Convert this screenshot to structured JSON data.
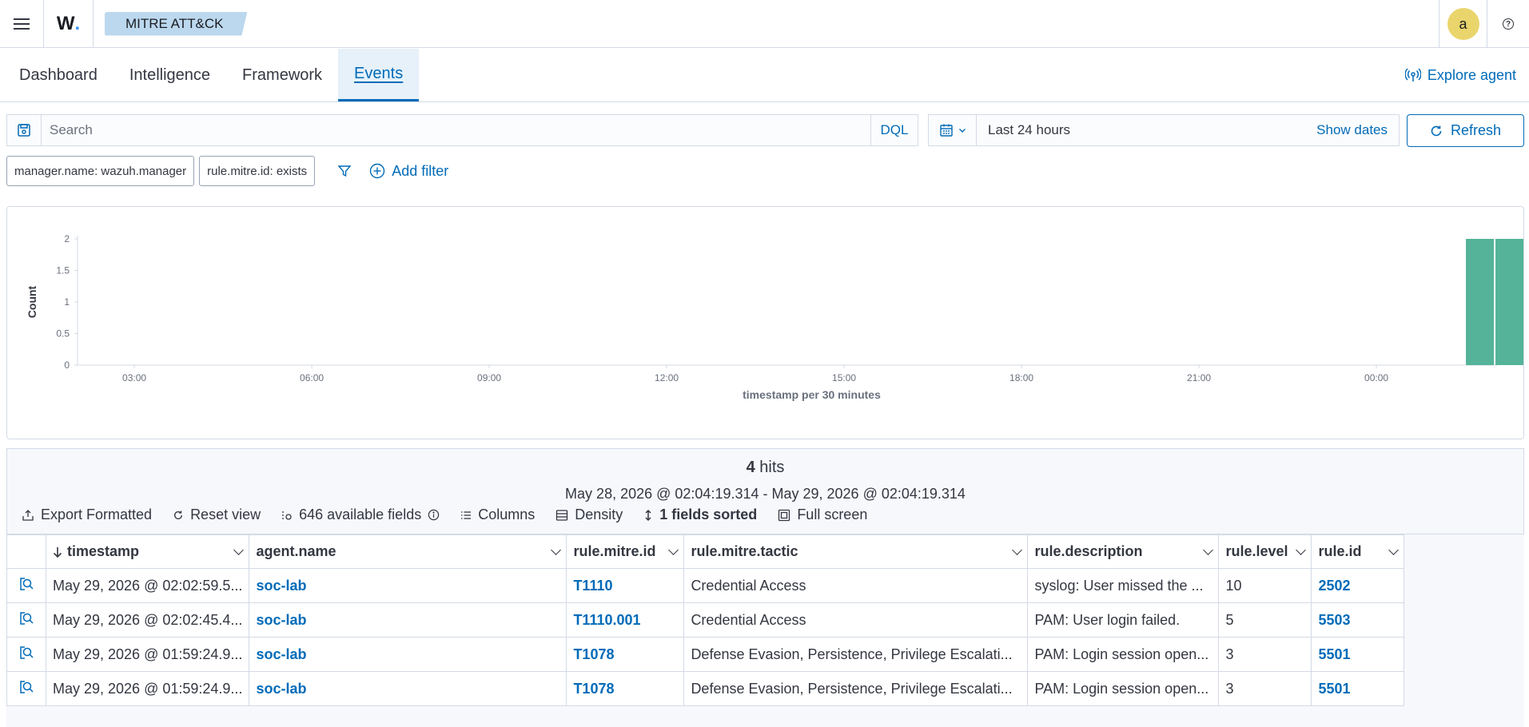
{
  "header": {
    "logo": "W",
    "breadcrumb": "MITRE ATT&CK",
    "avatar_letter": "a",
    "help_glyph": "?"
  },
  "tabs": [
    {
      "label": "Dashboard",
      "active": false
    },
    {
      "label": "Intelligence",
      "active": false
    },
    {
      "label": "Framework",
      "active": false
    },
    {
      "label": "Events",
      "active": true
    }
  ],
  "explore_agent": "Explore agent",
  "query": {
    "placeholder": "Search",
    "value": "",
    "language": "DQL"
  },
  "date": {
    "range": "Last 24 hours",
    "show_dates": "Show dates",
    "refresh": "Refresh"
  },
  "filters": {
    "pills": [
      "manager.name: wazuh.manager",
      "rule.mitre.id: exists"
    ],
    "add_filter": "Add filter"
  },
  "chart_data": {
    "type": "bar",
    "xlabel": "timestamp per 30 minutes",
    "ylabel": "Count",
    "x_ticks": [
      "03:00",
      "06:00",
      "09:00",
      "12:00",
      "15:00",
      "18:00",
      "21:00",
      "00:00"
    ],
    "y_ticks": [
      "0",
      "0.5",
      "1",
      "1.5",
      "2"
    ],
    "ylim": [
      0,
      2
    ],
    "x_domain_hours": [
      2.04,
      26.04
    ],
    "bars": [
      {
        "start_hour": 25.5,
        "value": 2
      },
      {
        "start_hour": 26.0,
        "value": 2
      }
    ],
    "color": "#54b399",
    "grid": false
  },
  "hits": {
    "count": "4",
    "label": "hits",
    "range": "May 28, 2026 @ 02:04:19.314 - May 29, 2026 @ 02:04:19.314"
  },
  "toolbar": {
    "export": "Export Formatted",
    "reset": "Reset view",
    "fields": "646 available fields",
    "columns": "Columns",
    "density": "Density",
    "sorted": "1 fields sorted",
    "fullscreen": "Full screen"
  },
  "table": {
    "columns": [
      "timestamp",
      "agent.name",
      "rule.mitre.id",
      "rule.mitre.tactic",
      "rule.description",
      "rule.level",
      "rule.id"
    ],
    "rows": [
      [
        "May 29, 2026 @ 02:02:59.5...",
        "soc-lab",
        "T1110",
        "Credential Access",
        "syslog: User missed the ...",
        "10",
        "2502"
      ],
      [
        "May 29, 2026 @ 02:02:45.4...",
        "soc-lab",
        "T1110.001",
        "Credential Access",
        "PAM: User login failed.",
        "5",
        "5503"
      ],
      [
        "May 29, 2026 @ 01:59:24.9...",
        "soc-lab",
        "T1078",
        "Defense Evasion, Persistence, Privilege Escalati...",
        "PAM: Login session open...",
        "3",
        "5501"
      ],
      [
        "May 29, 2026 @ 01:59:24.9...",
        "soc-lab",
        "T1078",
        "Defense Evasion, Persistence, Privilege Escalati...",
        "PAM: Login session open...",
        "3",
        "5501"
      ]
    ]
  },
  "colors": {
    "accent": "#006bb8",
    "bar": "#54b399",
    "breadcrumb_bg": "#bcd8ee",
    "avatar_bg": "#e9d56c"
  }
}
